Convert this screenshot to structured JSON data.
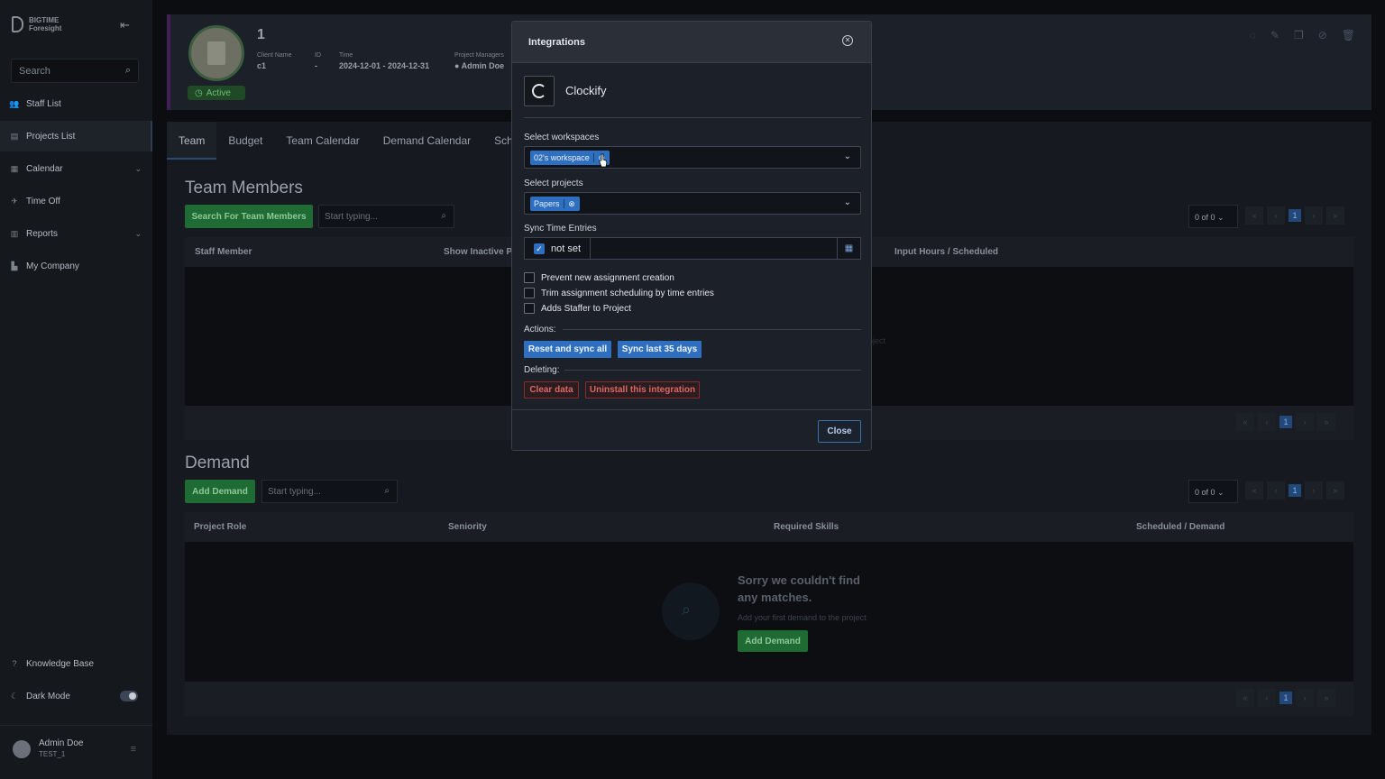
{
  "brand": {
    "line1": "BIGTIME",
    "line2": "Foresight"
  },
  "sidebar": {
    "search_placeholder": "Search",
    "items": [
      {
        "label": "Staff List",
        "icon": "people-icon"
      },
      {
        "label": "Projects List",
        "icon": "clipboard-icon",
        "active": true
      },
      {
        "label": "Calendar",
        "icon": "calendar-icon",
        "expandable": true
      },
      {
        "label": "Time Off",
        "icon": "plane-icon"
      },
      {
        "label": "Reports",
        "icon": "report-icon",
        "expandable": true
      },
      {
        "label": "My Company",
        "icon": "building-icon"
      }
    ],
    "knowledge_base": "Knowledge Base",
    "dark_mode": "Dark Mode",
    "dark_mode_on": true,
    "user": {
      "name": "Admin Doe",
      "sub": "TEST_1"
    }
  },
  "project": {
    "title": "1",
    "status": "Active",
    "meta": [
      {
        "key": "Client Name",
        "value": "c1"
      },
      {
        "key": "ID",
        "value": "-"
      },
      {
        "key": "Time",
        "value": "2024-12-01 - 2024-12-31"
      },
      {
        "key": "Project Managers",
        "value": "Admin Doe"
      }
    ]
  },
  "tabs": [
    "Team",
    "Budget",
    "Team Calendar",
    "Demand Calendar",
    "Sched"
  ],
  "team": {
    "title": "Team Members",
    "search_button": "Search For Team Members",
    "search_placeholder": "Start typing...",
    "count": "0 of 0",
    "page": "1",
    "columns": [
      "Staff Member",
      "Show Inactive Pe",
      "Input Hours / Scheduled"
    ],
    "faint_text": "oject"
  },
  "demand": {
    "title": "Demand",
    "add_button": "Add Demand",
    "search_placeholder": "Start typing...",
    "count": "0 of 0",
    "page": "1",
    "columns": [
      "Project Role",
      "Seniority",
      "Required Skills",
      "Scheduled / Demand"
    ],
    "empty_title": "Sorry we couldn't find any matches.",
    "empty_sub": "Add your first demand to the project",
    "empty_button": "Add Demand"
  },
  "modal": {
    "title": "Integrations",
    "integration_name": "Clockify",
    "workspaces_label": "Select workspaces",
    "workspace_tag": "02's workspace",
    "projects_label": "Select projects",
    "project_tag": "Papers",
    "sync_label": "Sync Time Entries",
    "sync_value": "not set",
    "checkboxes": [
      "Prevent new assignment creation",
      "Trim assignment scheduling by time entries",
      "Adds Staffer to Project"
    ],
    "actions_label": "Actions:",
    "reset_button": "Reset and sync all",
    "sync_button": "Sync last 35 days",
    "deleting_label": "Deleting:",
    "clear_button": "Clear data",
    "uninstall_button": "Uninstall this integration",
    "close_button": "Close"
  },
  "colors": {
    "accent_blue": "#2f6fc0",
    "green": "#1f6b34",
    "danger": "#e26464"
  }
}
